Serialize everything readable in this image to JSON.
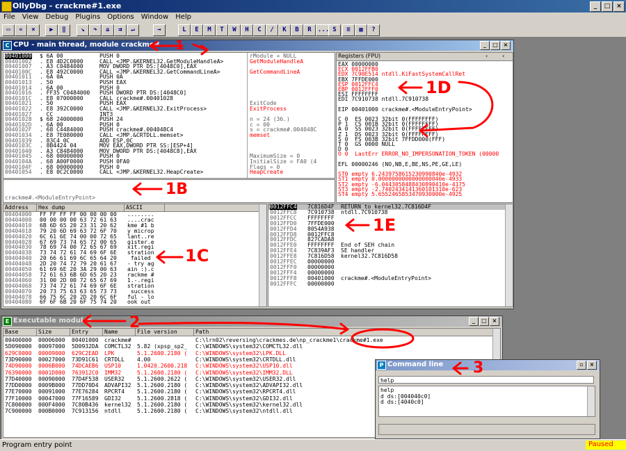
{
  "app": {
    "title": "OllyDbg - crackme#1.exe"
  },
  "menu": [
    "File",
    "View",
    "Debug",
    "Plugins",
    "Options",
    "Window",
    "Help"
  ],
  "toolbar": {
    "letters": [
      "L",
      "E",
      "M",
      "T",
      "W",
      "H",
      "C",
      "/",
      "K",
      "B",
      "R",
      "...",
      "S"
    ]
  },
  "cpu": {
    "title": "CPU - main thread, module crackme#",
    "disasm": [
      {
        "addr": "00401000",
        "hex": "$ 6A 00",
        "asm": "PUSH 0",
        "cmt": "rModule = NULL"
      },
      {
        "addr": "00401002",
        "hex": ". E8 4D2C0000",
        "asm": "CALL <JMP.&KERNEL32.GetModuleHandleA>",
        "cmt": "GetModuleHandleA"
      },
      {
        "addr": "00401007",
        "hex": ". A3 C0484000",
        "asm": "MOV DWORD PTR DS:[4048C0],EAX",
        "cmt": ""
      },
      {
        "addr": "0040100C",
        "hex": ". E8 492C0000",
        "asm": "CALL <JMP.&KERNEL32.GetCommandLineA>",
        "cmt": "GetCommandLineA"
      },
      {
        "addr": "00401011",
        "hex": ". 6A 0A",
        "asm": "PUSH 0A",
        "cmt": ""
      },
      {
        "addr": "00401013",
        "hex": ". 50",
        "asm": "PUSH EAX",
        "cmt": ""
      },
      {
        "addr": "00401014",
        "hex": ". 6A 00",
        "asm": "PUSH 0",
        "cmt": ""
      },
      {
        "addr": "00401016",
        "hex": ". FF35 C0484000",
        "asm": "PUSH DWORD PTR DS:[4048C0]",
        "cmt": ""
      },
      {
        "addr": "0040101C",
        "hex": ". E8 07000000",
        "asm": "CALL crackme#.00401028",
        "cmt": ""
      },
      {
        "addr": "00401021",
        "hex": ". 50",
        "asm": "PUSH EAX",
        "cmt": "ExitCode"
      },
      {
        "addr": "00401022",
        "hex": ". E8 392C0000",
        "asm": "CALL <JMP.&KERNEL32.ExitProcess>",
        "cmt": "ExitProcess"
      },
      {
        "addr": "00401027",
        "hex": "  CC",
        "asm": "INT3",
        "cmt": ""
      },
      {
        "addr": "00401028",
        "hex": "$ 68 24000000",
        "asm": "PUSH 24",
        "cmt": "n = 24 (36.)"
      },
      {
        "addr": "0040102D",
        "hex": ". 6A 00",
        "asm": "PUSH 0",
        "cmt": "c = 00"
      },
      {
        "addr": "0040102F",
        "hex": ". 68 C4484000",
        "asm": "PUSH crackme#.004048C4",
        "cmt": "s = crackme#.004048C"
      },
      {
        "addr": "00401034",
        "hex": ". E8 7E080000",
        "asm": "CALL <JMP.&CRTDLL.memset>",
        "cmt": "memset"
      },
      {
        "addr": "00401039",
        "hex": ". 83C4 0C",
        "asm": "ADD ESP,0C",
        "cmt": ""
      },
      {
        "addr": "0040103C",
        "hex": ". 8B4424 04",
        "asm": "MOV EAX,DWORD PTR SS:[ESP+4]",
        "cmt": ""
      },
      {
        "addr": "00401040",
        "hex": ". A3 C8484000",
        "asm": "MOV DWORD PTR DS:[4048C8],EAX",
        "cmt": ""
      },
      {
        "addr": "00401045",
        "hex": ". 68 00000000",
        "asm": "PUSH 0",
        "cmt": "MaximumSize = 0"
      },
      {
        "addr": "0040104A",
        "hex": ". 68 A00F0000",
        "asm": "PUSH 0FA0",
        "cmt": "InitialSize = FA0 (4"
      },
      {
        "addr": "0040104F",
        "hex": ". 68 00000000",
        "asm": "PUSH 0",
        "cmt": "Flags = 0"
      },
      {
        "addr": "00401054",
        "hex": ". E8 0C2C0000",
        "asm": "CALL <JMP.&KERNEL32.HeapCreate>",
        "cmt": "HeapCreate"
      }
    ],
    "info": "crackme#.<ModuleEntryPoint>",
    "registers": {
      "title": "Registers (FPU)",
      "lines": [
        {
          "t": "EAX 00000000",
          "red": false
        },
        {
          "t": "ECX 0012FFB0",
          "red": true
        },
        {
          "t": "EDX 7C90E514 ntdll.KiFastSystemCallRet",
          "red": true
        },
        {
          "t": "EBX 7FFDE000",
          "red": false
        },
        {
          "t": "ESP 0012FFC4",
          "red": true
        },
        {
          "t": "EBP 0012FFF0",
          "red": true
        },
        {
          "t": "ESI FFFFFFFF",
          "red": false
        },
        {
          "t": "EDI 7C910738 ntdll.7C910738",
          "red": false
        },
        {
          "t": "",
          "red": false
        },
        {
          "t": "EIP 00401000 crackme#.<ModuleEntryPoint>",
          "red": false
        },
        {
          "t": "",
          "red": false
        },
        {
          "t": "C 0  ES 0023 32bit 0(FFFFFFFF)",
          "red": false
        },
        {
          "t": "P 1  CS 001B 32bit 0(FFFFFFFF)",
          "red": false
        },
        {
          "t": "A 0  SS 0023 32bit 0(FFFFFFFF)",
          "red": false
        },
        {
          "t": "Z 1  DS 0023 32bit 0(FFFFFFFF)",
          "red": false
        },
        {
          "t": "S 0  FS 003B 32bit 7FFDD000(FFF)",
          "red": false
        },
        {
          "t": "T 0  GS 0000 NULL",
          "red": false
        },
        {
          "t": "D 0",
          "red": false
        },
        {
          "t": "O 0  LastErr ERROR_NO_IMPERSONATION_TOKEN (00000",
          "red": true
        },
        {
          "t": "",
          "red": false
        },
        {
          "t": "EFL 00000246 (NO,NB,E,BE,NS,PE,GE,LE)",
          "red": false
        },
        {
          "t": "",
          "red": false
        },
        {
          "t": "ST0 empty 6.2439758615230990840e-4932",
          "red": true
        },
        {
          "t": "ST1 empty 0.0000000000000000040e-4933",
          "red": true
        },
        {
          "t": "ST2 empty -6.0443058488430890410e-4175",
          "red": true
        },
        {
          "t": "ST3 empty -2.7402434141360101310e-623",
          "red": true
        },
        {
          "t": "ST4 empty 5.6552465853470930000e-4925",
          "red": true
        }
      ]
    },
    "dump": {
      "headers": [
        "Address",
        "Hex dump",
        "ASCII"
      ],
      "rows": [
        [
          "00404000",
          "FF FF FF FF 00 00 00 00",
          "........"
        ],
        [
          "00404008",
          "00 00 00 00 63 72 61 63",
          "....crac"
        ],
        [
          "00404010",
          "6B 6D 65 20 23 31 20 62",
          "kme #1 b"
        ],
        [
          "00404018",
          "79 20 6D 69 63 72 6F 70",
          "y microp"
        ],
        [
          "00404020",
          "6C 61 6E 74 00 00 72 65",
          "lant..re"
        ],
        [
          "00404028",
          "67 69 73 74 65 72 00 65",
          "gister.e"
        ],
        [
          "00404030",
          "78 69 74 00 72 65 67 69",
          "xit.regi"
        ],
        [
          "00404038",
          "73 74 72 61 74 69 6F 6E",
          "stration"
        ],
        [
          "00404040",
          "20 66 61 69 6C 65 64 20",
          " failed "
        ],
        [
          "00404048",
          "2D 20 74 72 79 20 61 67",
          "- try ag"
        ],
        [
          "00404050",
          "61 69 6E 20 3A 29 00 63",
          "ain :).c"
        ],
        [
          "00404058",
          "72 61 63 6B 6D 65 20 23",
          "rackme #"
        ],
        [
          "00404060",
          "31 00 2D 00 72 65 67 69",
          "1.-.regi"
        ],
        [
          "00404068",
          "73 74 72 61 74 69 6F 6E",
          "stration"
        ],
        [
          "00404070",
          "20 73 75 63 63 65 73 73",
          " success"
        ],
        [
          "00404078",
          "66 75 6C 20 2D 20 6C 6F",
          "ful - lo"
        ],
        [
          "00404080",
          "6F 6F 6B 20 6F 75 74 20",
          "ook out "
        ]
      ]
    },
    "stack": {
      "rows": [
        [
          "0012FFC4",
          "7C816D4F",
          "RETURN to kernel32.7C816D4F"
        ],
        [
          "0012FFC8",
          "7C910738",
          "ntdll.7C910738"
        ],
        [
          "0012FFCC",
          "FFFFFFFF",
          ""
        ],
        [
          "0012FFD0",
          "7FFDE000",
          ""
        ],
        [
          "0012FFD4",
          "8054A938",
          ""
        ],
        [
          "0012FFD8",
          "0012FFC8",
          ""
        ],
        [
          "0012FFDC",
          "827CADA8",
          ""
        ],
        [
          "0012FFE0",
          "FFFFFFFF",
          "End of SEH chain"
        ],
        [
          "0012FFE4",
          "7C839AF3",
          "SE handler"
        ],
        [
          "0012FFE8",
          "7C816D58",
          "kernel32.7C816D58"
        ],
        [
          "0012FFEC",
          "00000000",
          ""
        ],
        [
          "0012FFF0",
          "00000000",
          ""
        ],
        [
          "0012FFF4",
          "00000000",
          ""
        ],
        [
          "0012FFF8",
          "00401000",
          "crackme#.<ModuleEntryPoint>"
        ],
        [
          "0012FFFC",
          "00000000",
          ""
        ]
      ]
    }
  },
  "modules": {
    "title": "Executable modules",
    "headers": [
      "Base",
      "Size",
      "Entry",
      "Name",
      "File version",
      "Path"
    ],
    "rows": [
      {
        "c": [
          "00400000",
          "00006000",
          "00401000",
          "crackme#",
          "",
          "C:\\lrn02\\reversing\\crackmes.de\\np_crackme1\\crackme#1.exe"
        ],
        "red": false
      },
      {
        "c": [
          "5D090000",
          "00097000",
          "5D0932DA",
          "COMCTL32",
          "5.82 (xpsp_sp2_",
          "C:\\WINDOWS\\system32\\COMCTL32.dll"
        ],
        "red": false
      },
      {
        "c": [
          "629C0000",
          "00009000",
          "629C2EAD",
          "LPK",
          "5.1.2600.2180 (",
          "C:\\WINDOWS\\system32\\LPK.DLL"
        ],
        "red": true
      },
      {
        "c": [
          "73D90000",
          "00027000",
          "73D91C61",
          "CRTDLL",
          "4.00",
          "C:\\WINDOWS\\system32\\CRTDLL.dll"
        ],
        "red": false
      },
      {
        "c": [
          "74D90000",
          "0006B000",
          "74DCAEB6",
          "USP10",
          "1.0420.2600.218",
          "C:\\WINDOWS\\system32\\USP10.dll"
        ],
        "red": true
      },
      {
        "c": [
          "76390000",
          "0001D000",
          "763912C0",
          "IMM32",
          "5.1.2600.2180 (",
          "C:\\WINDOWS\\system32\\IMM32.DLL"
        ],
        "red": true
      },
      {
        "c": [
          "77D40000",
          "00090000",
          "77D4F538",
          "USER32",
          "5.1.2600.2622 (",
          "C:\\WINDOWS\\system32\\USER32.dll"
        ],
        "red": false
      },
      {
        "c": [
          "77DD0000",
          "0009B000",
          "77DD70D4",
          "ADVAPI32",
          "5.1.2600.2180 (",
          "C:\\WINDOWS\\system32\\ADVAPI32.dll"
        ],
        "red": false
      },
      {
        "c": [
          "77E70000",
          "00091000",
          "77E76284",
          "RPCRT4",
          "5.1.2600.2180 (",
          "C:\\WINDOWS\\system32\\RPCRT4.dll"
        ],
        "red": false
      },
      {
        "c": [
          "77F10000",
          "00047000",
          "77F16589",
          "GDI32",
          "5.1.2600.2818 (",
          "C:\\WINDOWS\\system32\\GDI32.dll"
        ],
        "red": false
      },
      {
        "c": [
          "7C800000",
          "000F4000",
          "7C80B436",
          "kernel32",
          "5.1.2600.2180 (",
          "C:\\WINDOWS\\system32\\kernel32.dll"
        ],
        "red": false
      },
      {
        "c": [
          "7C900000",
          "000B0000",
          "7C913156",
          "ntdll",
          "5.1.2600.2180 (",
          "C:\\WINDOWS\\system32\\ntdll.dll"
        ],
        "red": false
      }
    ]
  },
  "cmdline": {
    "title": "Command line",
    "input": "help",
    "history": [
      "help",
      "d ds:[004040c0]",
      "d ds:[4040c0]"
    ]
  },
  "status": {
    "text": "Program entry point",
    "state": "Paused"
  },
  "annotations": [
    "1",
    "1B",
    "1C",
    "1D",
    "1E",
    "2",
    "3"
  ],
  "colors": {
    "annot": "#ff0000",
    "titleActive": "#0a246a",
    "paused": "#ffff00"
  }
}
